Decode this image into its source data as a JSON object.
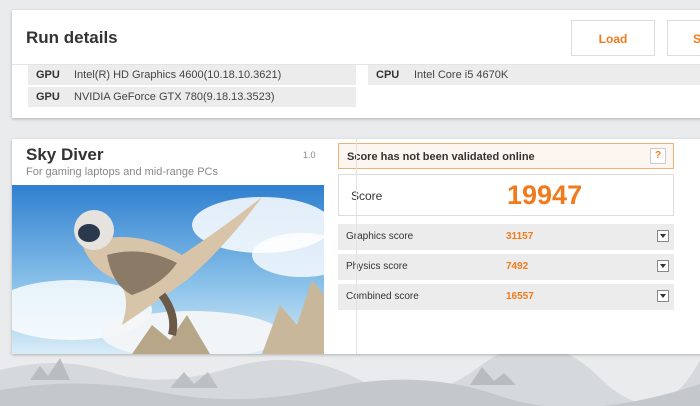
{
  "run_details": {
    "title": "Run details",
    "load_label": "Load",
    "save_label": "S",
    "specs": [
      {
        "key": "GPU",
        "value": "Intel(R) HD Graphics 4600(10.18.10.3621)"
      },
      {
        "key": "GPU",
        "value": "NVIDIA GeForce GTX 780(9.18.13.3523)"
      },
      {
        "key": "CPU",
        "value": "Intel Core i5 4670K"
      }
    ]
  },
  "test": {
    "title": "Sky Diver",
    "subtitle": "For gaming laptops and mid-range PCs",
    "version": "1.0",
    "validation_message": "Score has not been validated online",
    "help_label": "?",
    "score_label": "Score",
    "score_value": "19947",
    "subscores": [
      {
        "label": "Graphics score",
        "value": "31157"
      },
      {
        "label": "Physics score",
        "value": "7492"
      },
      {
        "label": "Combined score",
        "value": "16557"
      }
    ]
  },
  "colors": {
    "accent": "#f07a1c",
    "panel": "#ffffff",
    "row": "#ececec"
  },
  "icons": {
    "dropdown": "chevron-down-icon",
    "help": "help-icon"
  }
}
